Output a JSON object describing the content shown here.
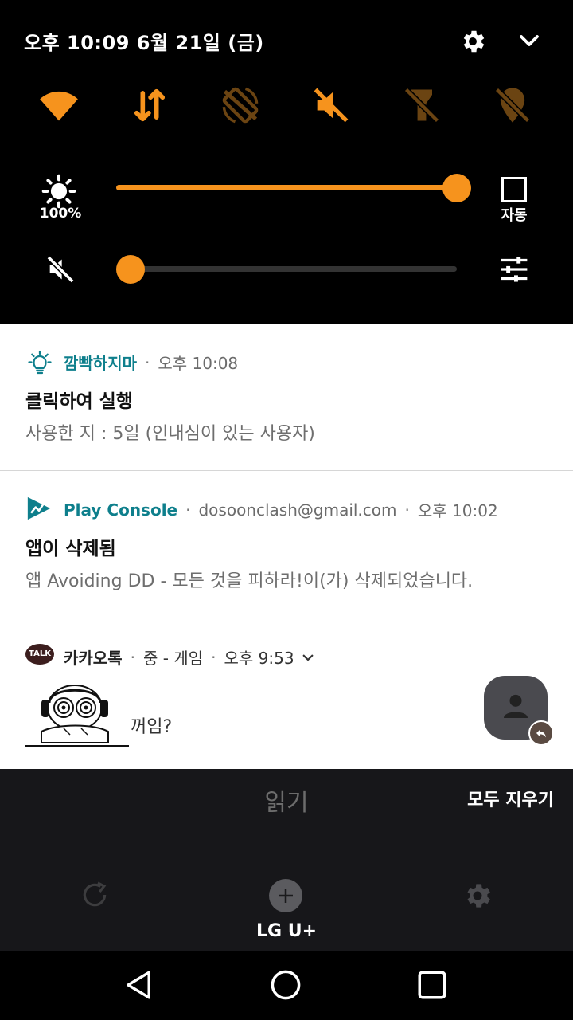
{
  "status": {
    "datetime": "오후 10:09 6월 21일 (금)"
  },
  "brightness": {
    "level": 1.0,
    "percent_label": "100%",
    "auto_label": "자동"
  },
  "volume": {
    "level": 0.0
  },
  "notifications": [
    {
      "app": "깜빡하지마",
      "time": "오후 10:08",
      "title": "클릭하여 실행",
      "text": "사용한 지 : 5일 (인내심이 있는 사용자)",
      "icon": "lightbulb-icon"
    },
    {
      "app": "Play Console",
      "account": "dosoonclash@gmail.com",
      "time": "오후 10:02",
      "title": "앱이 삭제됨",
      "text": "앱 Avoiding DD - 모든 것을 피하라!이(가) 삭제되었습니다.",
      "icon": "play-console-icon"
    },
    {
      "app": "카카오톡",
      "channel": "중 - 게임",
      "time": "오후 9:53",
      "message": "꺼임?",
      "icon": "kakaotalk-icon",
      "badge": "TALK"
    }
  ],
  "bottom": {
    "read_label": "읽기",
    "clear_all_label": "모두 지우기",
    "carrier": "LG U+"
  },
  "colors": {
    "accent": "#f6931d",
    "panel": "#000000",
    "teal": "#0e7f8c"
  }
}
